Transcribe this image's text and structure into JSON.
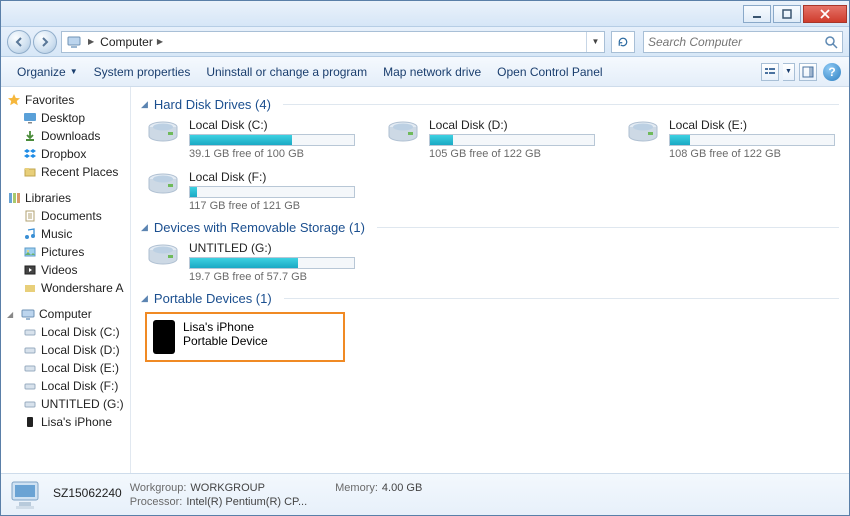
{
  "titlebar": {},
  "nav": {
    "breadcrumb": "Computer",
    "search_placeholder": "Search Computer"
  },
  "toolbar": {
    "organize": "Organize",
    "system_properties": "System properties",
    "uninstall": "Uninstall or change a program",
    "map_drive": "Map network drive",
    "control_panel": "Open Control Panel"
  },
  "sidebar": {
    "favorites": {
      "label": "Favorites",
      "items": [
        "Desktop",
        "Downloads",
        "Dropbox",
        "Recent Places"
      ]
    },
    "libraries": {
      "label": "Libraries",
      "items": [
        "Documents",
        "Music",
        "Pictures",
        "Videos",
        "Wondershare A"
      ]
    },
    "computer": {
      "label": "Computer",
      "items": [
        "Local Disk (C:)",
        "Local Disk (D:)",
        "Local Disk (E:)",
        "Local Disk (F:)",
        "UNTITLED (G:)",
        "Lisa's iPhone"
      ]
    }
  },
  "content": {
    "groups": {
      "hdd": {
        "label": "Hard Disk Drives (4)",
        "items": [
          {
            "name": "Local Disk (C:)",
            "free": "39.1 GB free of 100 GB",
            "fill": 62
          },
          {
            "name": "Local Disk (D:)",
            "free": "105 GB free of 122 GB",
            "fill": 14
          },
          {
            "name": "Local Disk (E:)",
            "free": "108 GB free of 122 GB",
            "fill": 12
          },
          {
            "name": "Local Disk (F:)",
            "free": "117 GB free of 121 GB",
            "fill": 4
          }
        ]
      },
      "removable": {
        "label": "Devices with Removable Storage (1)",
        "items": [
          {
            "name": "UNTITLED (G:)",
            "free": "19.7 GB free of 57.7 GB",
            "fill": 66
          }
        ]
      },
      "portable": {
        "label": "Portable Devices (1)",
        "items": [
          {
            "name": "Lisa's iPhone",
            "sub": "Portable Device"
          }
        ]
      }
    }
  },
  "status": {
    "name": "SZ15062240",
    "workgroup_label": "Workgroup:",
    "workgroup": "WORKGROUP",
    "processor_label": "Processor:",
    "processor": "Intel(R) Pentium(R) CP...",
    "memory_label": "Memory:",
    "memory": "4.00 GB"
  }
}
